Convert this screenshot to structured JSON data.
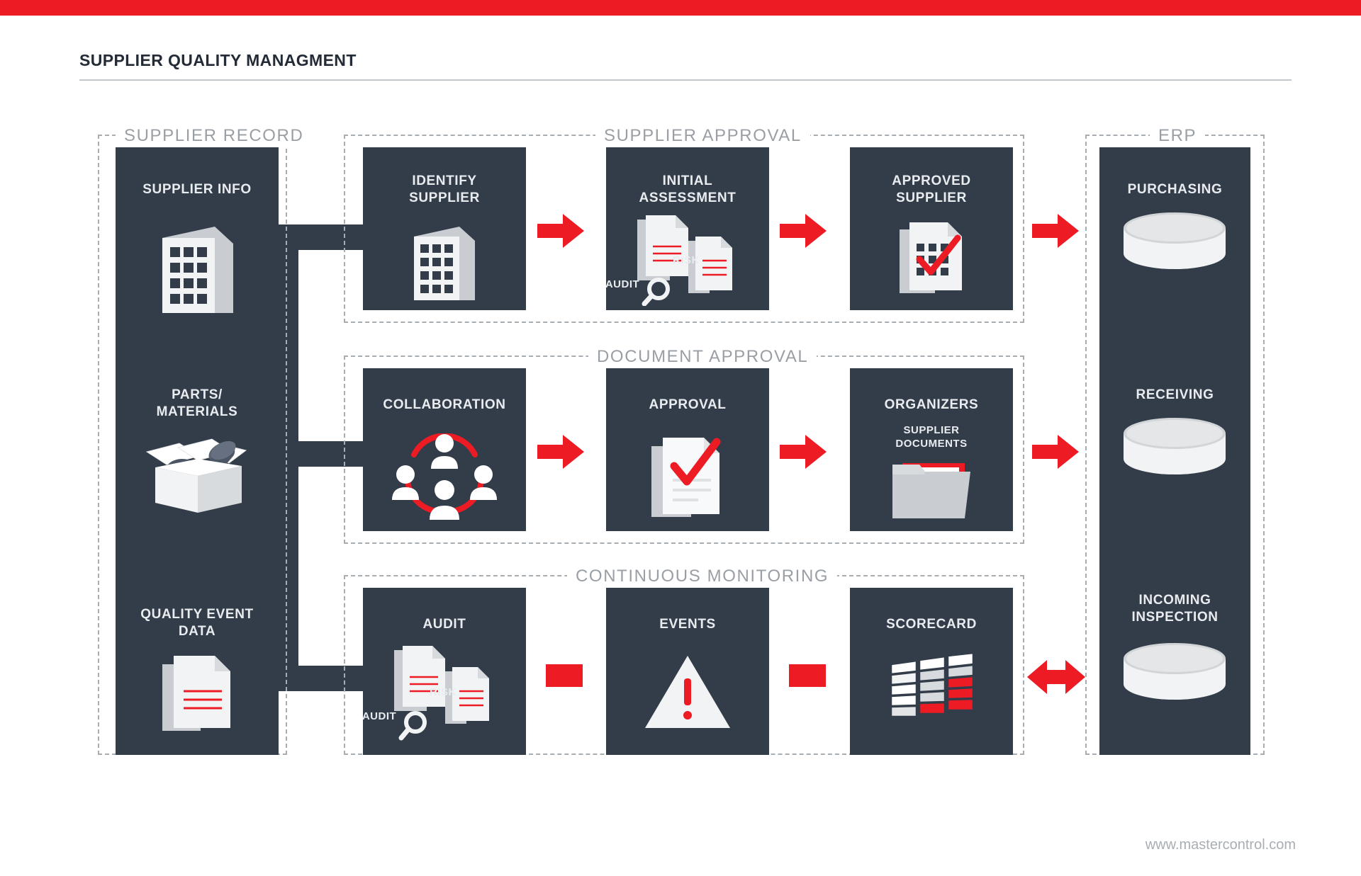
{
  "meta": {
    "accent_red": "#ed1c24",
    "node_dark": "#333d4a",
    "dashed_gray": "#a8adb2",
    "label_gray": "#9a9fa5"
  },
  "header": {
    "title": "SUPPLIER QUALITY MANAGMENT"
  },
  "footer": {
    "url": "www.mastercontrol.com"
  },
  "groups": {
    "supplier_record": "SUPPLIER RECORD",
    "supplier_approval": "SUPPLIER APPROVAL",
    "document_approval": "DOCUMENT APPROVAL",
    "continuous_monitoring": "CONTINUOUS MONITORING",
    "erp": "ERP"
  },
  "supplier_record": {
    "items": [
      {
        "label": "SUPPLIER INFO",
        "icon": "office-building-icon"
      },
      {
        "label_line1": "PARTS/",
        "label_line2": "MATERIALS",
        "icon": "open-box-parts-icon"
      },
      {
        "label_line1": "QUALITY EVENT",
        "label_line2": "DATA",
        "icon": "documents-icon"
      }
    ]
  },
  "supplier_approval": {
    "nodes": [
      {
        "label_line1": "IDENTIFY",
        "label_line2": "SUPPLIER",
        "icon": "office-building-icon"
      },
      {
        "label_line1": "INITIAL",
        "label_line2": "ASSESSMENT",
        "icon": "audit-risk-icon",
        "tag_audit": "AUDIT",
        "tag_risk": "RISK"
      },
      {
        "label_line1": "APPROVED",
        "label_line2": "SUPPLIER",
        "icon": "approved-document-icon"
      }
    ],
    "connector_1": "arrow-right-icon",
    "connector_2": "arrow-right-icon",
    "connector_out": "arrow-right-icon"
  },
  "document_approval": {
    "nodes": [
      {
        "label": "COLLABORATION",
        "icon": "collaboration-people-icon"
      },
      {
        "label": "APPROVAL",
        "icon": "approved-document-icon"
      },
      {
        "label": "ORGANIZERS",
        "sub_line1": "SUPPLIER",
        "sub_line2": "DOCUMENTS",
        "icon": "folder-documents-icon"
      }
    ],
    "connector_1": "arrow-right-icon",
    "connector_2": "arrow-right-icon",
    "connector_out": "arrow-right-icon"
  },
  "continuous_monitoring": {
    "nodes": [
      {
        "label": "AUDIT",
        "icon": "audit-risk-icon",
        "tag_audit": "AUDIT",
        "tag_risk": "RISK"
      },
      {
        "label": "EVENTS",
        "icon": "warning-triangle-icon"
      },
      {
        "label": "SCORECARD",
        "icon": "scorecard-grid-icon"
      }
    ],
    "connector_1": "red-bar-icon",
    "connector_2": "red-bar-icon",
    "connector_out": "arrow-both-icon"
  },
  "erp": {
    "items": [
      {
        "label": "PURCHASING",
        "icon": "database-cylinder-icon"
      },
      {
        "label": "RECEIVING",
        "icon": "database-cylinder-icon"
      },
      {
        "label_line1": "INCOMING",
        "label_line2": "INSPECTION",
        "icon": "database-cylinder-icon"
      }
    ]
  }
}
